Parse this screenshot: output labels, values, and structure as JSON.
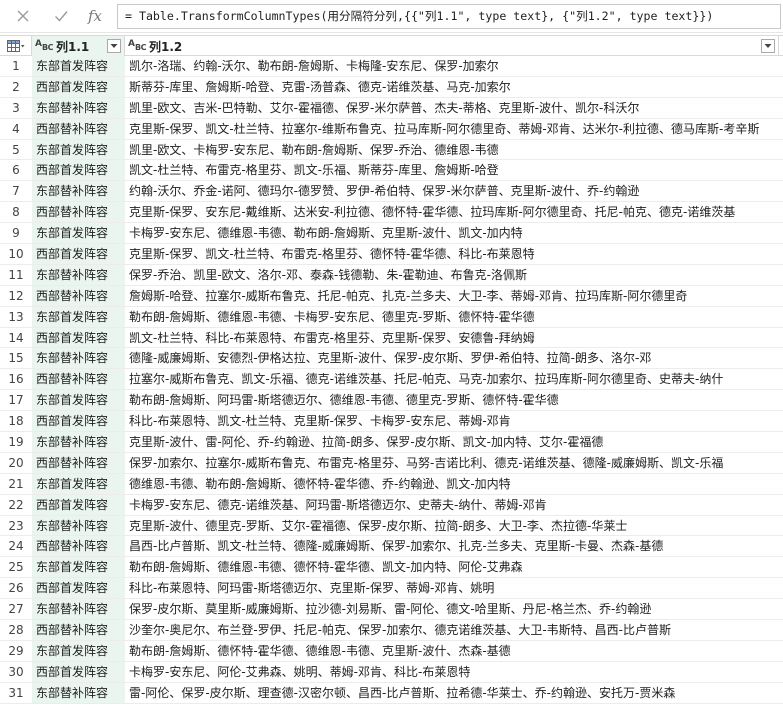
{
  "formula_bar": {
    "cancel_icon": "close-icon",
    "commit_icon": "check-icon",
    "fx_label": "fx",
    "formula": "= Table.TransformColumnTypes(用分隔符分列,{{\"列1.1\", type text}, {\"列1.2\", type text}})"
  },
  "table": {
    "columns": [
      {
        "label": "列1.1",
        "type_icon": "ABC"
      },
      {
        "label": "列1.2",
        "type_icon": "ABC"
      }
    ],
    "rows": [
      {
        "num": "1",
        "c1": "东部首发阵容",
        "c2": "凯尔-洛瑞、约翰-沃尔、勒布朗-詹姆斯、卡梅隆-安东尼、保罗-加索尔"
      },
      {
        "num": "2",
        "c1": "西部首发阵容",
        "c2": "斯蒂芬-库里、詹姆斯-哈登、克雷-汤普森、德克-诺维茨基、马克-加索尔"
      },
      {
        "num": "3",
        "c1": "东部替补阵容",
        "c2": "凯里-欧文、吉米-巴特勒、艾尔-霍福德、保罗-米尔萨普、杰夫-蒂格、克里斯-波什、凯尔-科沃尔"
      },
      {
        "num": "4",
        "c1": "西部替补阵容",
        "c2": "克里斯-保罗、凯文-杜兰特、拉塞尔-维斯布鲁克、拉马库斯-阿尔德里奇、蒂姆-邓肯、达米尔-利拉德、德马库斯-考辛斯"
      },
      {
        "num": "5",
        "c1": "东部首发阵容",
        "c2": "凯里-欧文、卡梅罗-安东尼、勒布朗-詹姆斯、保罗-乔治、德维恩-韦德"
      },
      {
        "num": "6",
        "c1": "西部首发阵容",
        "c2": "凯文-杜兰特、布雷克-格里芬、凯文-乐福、斯蒂芬-库里、詹姆斯-哈登"
      },
      {
        "num": "7",
        "c1": "东部替补阵容",
        "c2": "约翰-沃尔、乔金-诺阿、德玛尔-德罗赞、罗伊-希伯特、保罗-米尔萨普、克里斯-波什、乔-约翰逊"
      },
      {
        "num": "8",
        "c1": "西部替补阵容",
        "c2": "克里斯-保罗、安东尼-戴维斯、达米安-利拉德、德怀特-霍华德、拉玛库斯-阿尔德里奇、托尼-帕克、德克-诺维茨基"
      },
      {
        "num": "9",
        "c1": "东部首发阵容",
        "c2": "卡梅罗-安东尼、德维恩-韦德、勒布朗-詹姆斯、克里斯-波什、凯文-加内特"
      },
      {
        "num": "10",
        "c1": "西部首发阵容",
        "c2": "克里斯-保罗、凯文-杜兰特、布雷克-格里芬、德怀特-霍华德、科比-布莱恩特"
      },
      {
        "num": "11",
        "c1": "东部替补阵容",
        "c2": "保罗-乔治、凯里-欧文、洛尔-邓、泰森-钱德勒、朱-霍勒迪、布鲁克-洛佩斯"
      },
      {
        "num": "12",
        "c1": "西部替补阵容",
        "c2": "詹姆斯-哈登、拉塞尔-威斯布鲁克、托尼-帕克、扎克-兰多夫、大卫-李、蒂姆-邓肯、拉玛库斯-阿尔德里奇"
      },
      {
        "num": "13",
        "c1": "东部首发阵容",
        "c2": "勒布朗-詹姆斯、德维恩-韦德、卡梅罗-安东尼、德里克-罗斯、德怀特-霍华德"
      },
      {
        "num": "14",
        "c1": "西部首发阵容",
        "c2": "凯文-杜兰特、科比-布莱恩特、布雷克-格里芬、克里斯-保罗、安德鲁-拜纳姆"
      },
      {
        "num": "15",
        "c1": "东部替补阵容",
        "c2": "德隆-威廉姆斯、安德烈-伊格达拉、克里斯-波什、保罗-皮尔斯、罗伊-希伯特、拉简-朗多、洛尔-邓"
      },
      {
        "num": "16",
        "c1": "西部替补阵容",
        "c2": "拉塞尔-威斯布鲁克、凯文-乐福、德克-诺维茨基、托尼-帕克、马克-加索尔、拉玛库斯-阿尔德里奇、史蒂夫-纳什"
      },
      {
        "num": "17",
        "c1": "东部首发阵容",
        "c2": "勒布朗-詹姆斯、阿玛雷-斯塔德迈尔、德维恩-韦德、德里克-罗斯、德怀特-霍华德"
      },
      {
        "num": "18",
        "c1": "西部首发阵容",
        "c2": "科比-布莱恩特、凯文-杜兰特、克里斯-保罗、卡梅罗-安东尼、蒂姆-邓肯"
      },
      {
        "num": "19",
        "c1": "东部替补阵容",
        "c2": "克里斯-波什、雷-阿伦、乔-约翰逊、拉简-朗多、保罗-皮尔斯、凯文-加内特、艾尔-霍福德"
      },
      {
        "num": "20",
        "c1": "西部替补阵容",
        "c2": "保罗-加索尔、拉塞尔-威斯布鲁克、布雷克-格里芬、马努-吉诺比利、德克-诺维茨基、德隆-威廉姆斯、凯文-乐福"
      },
      {
        "num": "21",
        "c1": "东部首发阵容",
        "c2": "德维恩-韦德、勒布朗-詹姆斯、德怀特-霍华德、乔-约翰逊、凯文-加内特"
      },
      {
        "num": "22",
        "c1": "西部首发阵容",
        "c2": "卡梅罗-安东尼、德克-诺维茨基、阿玛雷-斯塔德迈尔、史蒂夫-纳什、蒂姆-邓肯"
      },
      {
        "num": "23",
        "c1": "东部替补阵容",
        "c2": "克里斯-波什、德里克-罗斯、艾尔-霍福德、保罗-皮尔斯、拉简-朗多、大卫-李、杰拉德-华莱士"
      },
      {
        "num": "24",
        "c1": "西部替补阵容",
        "c2": "昌西-比卢普斯、凯文-杜兰特、德隆-威廉姆斯、保罗-加索尔、扎克-兰多夫、克里斯-卡曼、杰森-基德"
      },
      {
        "num": "25",
        "c1": "东部首发阵容",
        "c2": "勒布朗-詹姆斯、德维恩-韦德、德怀特-霍华德、凯文-加内特、阿伦-艾弗森"
      },
      {
        "num": "26",
        "c1": "西部首发阵容",
        "c2": "科比-布莱恩特、阿玛雷-斯塔德迈尔、克里斯-保罗、蒂姆-邓肯、姚明"
      },
      {
        "num": "27",
        "c1": "东部替补阵容",
        "c2": "保罗-皮尔斯、莫里斯-威廉姆斯、拉沙德-刘易斯、雷-阿伦、德文-哈里斯、丹尼-格兰杰、乔-约翰逊"
      },
      {
        "num": "28",
        "c1": "西部替补阵容",
        "c2": "沙奎尔-奥尼尔、布兰登-罗伊、托尼-帕克、保罗-加索尔、德克诺维茨基、大卫-韦斯特、昌西-比卢普斯"
      },
      {
        "num": "29",
        "c1": "东部首发阵容",
        "c2": "勒布朗-詹姆斯、德怀特-霍华德、德维恩-韦德、克里斯-波什、杰森-基德"
      },
      {
        "num": "30",
        "c1": "西部首发阵容",
        "c2": "卡梅罗-安东尼、阿伦-艾弗森、姚明、蒂姆-邓肯、科比-布莱恩特"
      },
      {
        "num": "31",
        "c1": "东部替补阵容",
        "c2": "雷-阿伦、保罗-皮尔斯、理查德-汉密尔顿、昌西-比卢普斯、拉希德-华莱士、乔-约翰逊、安托万-贾米森"
      }
    ]
  }
}
